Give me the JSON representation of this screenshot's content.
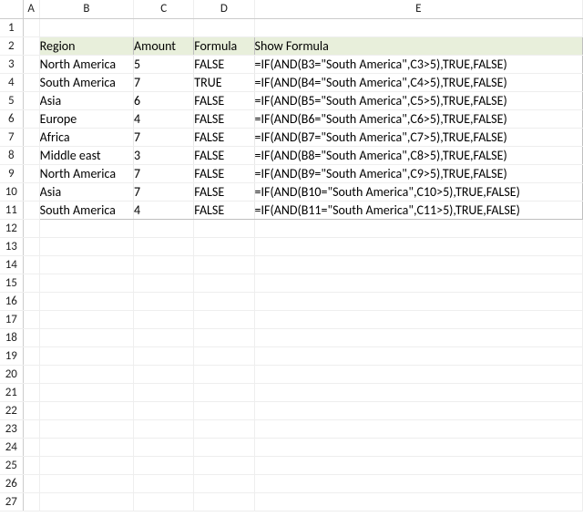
{
  "columns": [
    "A",
    "B",
    "C",
    "D",
    "E"
  ],
  "rowCount": 27,
  "headerRowIndex": 2,
  "header": {
    "region": "Region",
    "amount": "Amount",
    "formula": "Formula",
    "show": "Show Formula"
  },
  "rows": [
    {
      "region": "North America",
      "amount": "5",
      "formula": "FALSE",
      "show": "=IF(AND(B3=\"South America\",C3>5),TRUE,FALSE)"
    },
    {
      "region": "South America",
      "amount": "7",
      "formula": "TRUE",
      "show": "=IF(AND(B4=\"South America\",C4>5),TRUE,FALSE)"
    },
    {
      "region": "Asia",
      "amount": "6",
      "formula": "FALSE",
      "show": "=IF(AND(B5=\"South America\",C5>5),TRUE,FALSE)"
    },
    {
      "region": "Europe",
      "amount": "4",
      "formula": "FALSE",
      "show": "=IF(AND(B6=\"South America\",C6>5),TRUE,FALSE)"
    },
    {
      "region": "Africa",
      "amount": "7",
      "formula": "FALSE",
      "show": "=IF(AND(B7=\"South America\",C7>5),TRUE,FALSE)"
    },
    {
      "region": "Middle east",
      "amount": "3",
      "formula": "FALSE",
      "show": "=IF(AND(B8=\"South America\",C8>5),TRUE,FALSE)"
    },
    {
      "region": "North America",
      "amount": "7",
      "formula": "FALSE",
      "show": "=IF(AND(B9=\"South America\",C9>5),TRUE,FALSE)"
    },
    {
      "region": "Asia",
      "amount": "7",
      "formula": "FALSE",
      "show": "=IF(AND(B10=\"South America\",C10>5),TRUE,FALSE)"
    },
    {
      "region": "South America",
      "amount": "4",
      "formula": "FALSE",
      "show": "=IF(AND(B11=\"South America\",C11>5),TRUE,FALSE)"
    }
  ]
}
